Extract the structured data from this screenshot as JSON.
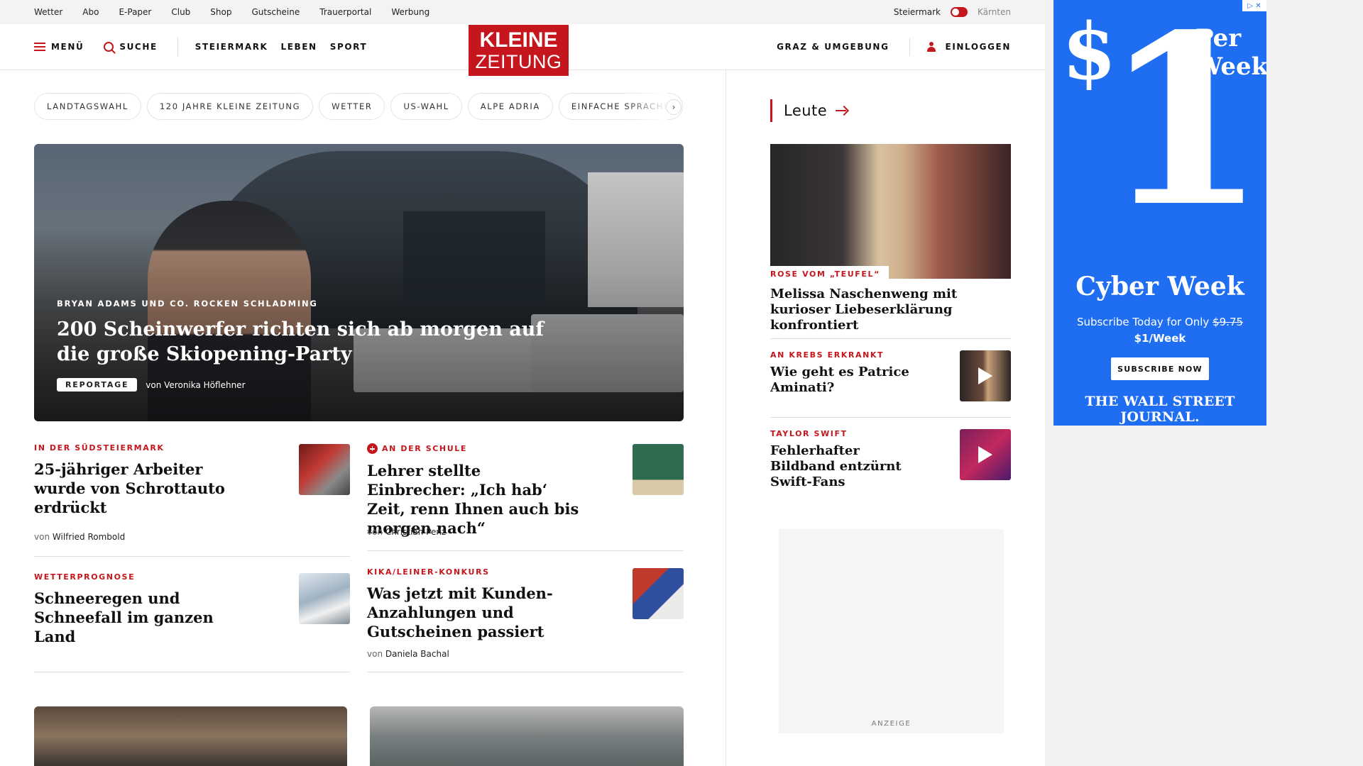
{
  "topbar": {
    "links": [
      "Wetter",
      "Abo",
      "E-Paper",
      "Club",
      "Shop",
      "Gutscheine",
      "Trauerportal",
      "Werbung"
    ],
    "region_active": "Steiermark",
    "region_inactive": "Kärnten"
  },
  "header": {
    "menu_label": "MENÜ",
    "search_label": "SUCHE",
    "sections": [
      "STEIERMARK",
      "LEBEN",
      "SPORT"
    ],
    "logo_line1": "KLEINE",
    "logo_line2": "ZEITUNG",
    "region_link": "GRAZ & UMGEBUNG",
    "login_label": "EINLOGGEN"
  },
  "pills": [
    "LANDTAGSWAHL",
    "120 JAHRE KLEINE ZEITUNG",
    "WETTER",
    "US-WAHL",
    "ALPE ADRIA",
    "EINFACHE SPRACHE"
  ],
  "hero": {
    "kicker": "BRYAN ADAMS UND CO. ROCKEN SCHLADMING",
    "title": "200 Scheinwerfer richten sich ab morgen auf die große Skiopening-Party",
    "badge": "REPORTAGE",
    "byline": "von Veronika Höflehner"
  },
  "articles": [
    {
      "kicker": "IN DER SÜDSTEIERMARK",
      "title": "25-jähriger Arbeiter wurde von Schrottauto erdrückt",
      "by": "von",
      "author": "Wilfried Rombold"
    },
    {
      "kicker": "AN DER SCHULE",
      "title": "Lehrer stellte Einbrecher: „Ich hab‘ Zeit, renn Ihnen auch bis morgen nach“",
      "by": "von",
      "author": "Christian Penz"
    },
    {
      "kicker": "WETTERPROGNOSE",
      "title": "Schneeregen und Schneefall im ganzen Land"
    },
    {
      "kicker": "KIKA/LEINER-KONKURS",
      "title": "Was jetzt mit Kunden-Anzahlungen und Gutscheinen passiert",
      "by": "von",
      "author": "Daniela Bachal"
    }
  ],
  "leute": {
    "heading": "Leute",
    "main_tag": "ROSE VOM „TEUFEL“",
    "main_title": "Melissa Naschenweng mit kurioser Liebeserklärung konfrontiert",
    "items": [
      {
        "kicker": "AN KREBS ERKRANKT",
        "title": "Wie geht es Patrice Aminati?"
      },
      {
        "kicker": "TAYLOR SWIFT",
        "title": "Fehlerhafter Bildband entzürnt Swift-Fans"
      }
    ]
  },
  "ad_label": "ANZEIGE",
  "wsj_ad": {
    "dollar": "$",
    "one": "1",
    "per_week": "Per Week",
    "cyber": "Cyber Week",
    "subscribe_text": "Subscribe Today for Only",
    "old_price": "$9.75",
    "new_price": "$1/Week",
    "button": "SUBSCRIBE NOW",
    "brand": "THE WALL STREET JOURNAL."
  }
}
